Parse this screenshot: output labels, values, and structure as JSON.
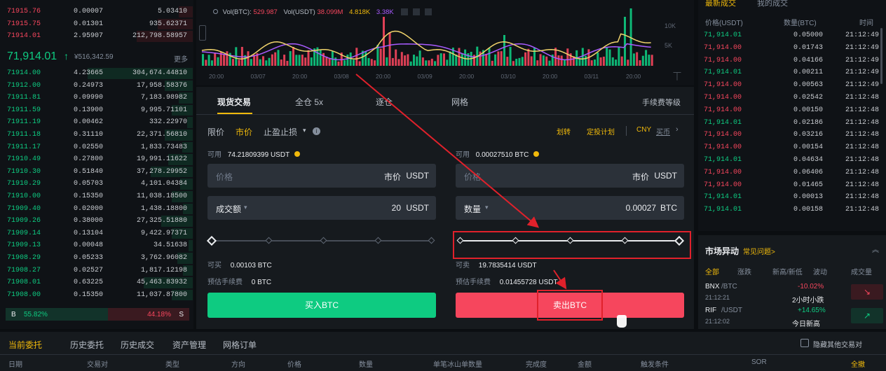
{
  "orderbook": {
    "asks": [
      {
        "price": "71915.76",
        "amount": "0.00007",
        "total": "5.03410"
      },
      {
        "price": "71915.75",
        "amount": "0.01301",
        "total": "935.62371"
      },
      {
        "price": "71914.01",
        "amount": "2.95907",
        "total": "212,798.58957"
      }
    ],
    "last_price": "71,914.01",
    "last_price_arrow": "↑",
    "last_price_fiat": "¥516,342.59",
    "more_label": "更多",
    "bids": [
      {
        "price": "71914.00",
        "amount": "4.23665",
        "total": "304,674.44810"
      },
      {
        "price": "71912.00",
        "amount": "0.24973",
        "total": "17,958.58376"
      },
      {
        "price": "71911.81",
        "amount": "0.09990",
        "total": "7,183.98982"
      },
      {
        "price": "71911.59",
        "amount": "0.13900",
        "total": "9,995.71101"
      },
      {
        "price": "71911.19",
        "amount": "0.00462",
        "total": "332.22970"
      },
      {
        "price": "71911.18",
        "amount": "0.31110",
        "total": "22,371.56810"
      },
      {
        "price": "71911.17",
        "amount": "0.02550",
        "total": "1,833.73483"
      },
      {
        "price": "71910.49",
        "amount": "0.27800",
        "total": "19,991.11622"
      },
      {
        "price": "71910.30",
        "amount": "0.51840",
        "total": "37,278.29952"
      },
      {
        "price": "71910.29",
        "amount": "0.05703",
        "total": "4,101.04384"
      },
      {
        "price": "71910.00",
        "amount": "0.15350",
        "total": "11,038.18500"
      },
      {
        "price": "71909.40",
        "amount": "0.02000",
        "total": "1,438.18800"
      },
      {
        "price": "71909.26",
        "amount": "0.38000",
        "total": "27,325.51880"
      },
      {
        "price": "71909.14",
        "amount": "0.13104",
        "total": "9,422.97371"
      },
      {
        "price": "71909.13",
        "amount": "0.00048",
        "total": "34.51638"
      },
      {
        "price": "71908.29",
        "amount": "0.05233",
        "total": "3,762.96082"
      },
      {
        "price": "71908.27",
        "amount": "0.02527",
        "total": "1,817.12198"
      },
      {
        "price": "71908.01",
        "amount": "0.63225",
        "total": "45,463.83932"
      },
      {
        "price": "71908.00",
        "amount": "0.15350",
        "total": "11,037.87800"
      }
    ],
    "ratio": {
      "b_label": "B",
      "b_pct": "55.82%",
      "s_pct": "44.18%",
      "s_label": "S",
      "b_fraction": 0.5582
    }
  },
  "chart": {
    "vol_btc_label": "Vol(BTC):",
    "vol_btc": "529.987",
    "vol_usdt_label": "Vol(USDT)",
    "vol_usdt": "38.099M",
    "v1": "4.818K",
    "v2": "3.38K",
    "y_ticks": [
      "10K",
      "5K"
    ],
    "x_ticks": [
      "20:00",
      "03/07",
      "20:00",
      "03/08",
      "20:00",
      "03/09",
      "20:00",
      "03/10",
      "20:00",
      "03/11",
      "20:00"
    ]
  },
  "trade_tabs": {
    "spot": "现货交易",
    "cross": "全仓 5x",
    "isolated": "逐仓",
    "grid": "网格",
    "fee": "手续费等级"
  },
  "order_types": {
    "limit": "限价",
    "market": "市价",
    "stop": "止盈止损",
    "transfer": "划转",
    "plan": "定投计划",
    "cny": "CNY",
    "buy_link": "买币"
  },
  "buy": {
    "avail_label": "可用",
    "avail": "74.21809399 USDT",
    "price_ph": "价格",
    "price_mode": "市价",
    "price_unit": "USDT",
    "amt_label": "成交额",
    "amt_value": "20",
    "amt_unit": "USDT",
    "can_label": "可买",
    "can_value": "0.00103 BTC",
    "fee_label": "预估手续费",
    "fee_value": "0 BTC",
    "button": "买入BTC"
  },
  "sell": {
    "avail_label": "可用",
    "avail": "0.00027510 BTC",
    "price_ph": "价格",
    "price_mode": "市价",
    "price_unit": "USDT",
    "amt_label": "数量",
    "amt_value": "0.00027",
    "amt_unit": "BTC",
    "can_label": "可卖",
    "can_value": "19.7835414 USDT",
    "fee_label": "预估手续费",
    "fee_value": "0.01455728 USDT",
    "button": "卖出BTC"
  },
  "trades": {
    "tab_latest": "最新成交",
    "tab_mine": "我的成交",
    "headers": [
      "价格(USDT)",
      "数量(BTC)",
      "时间"
    ],
    "rows": [
      {
        "price": "71,914.01",
        "amount": "0.05000",
        "time": "21:12:49",
        "side": "buy"
      },
      {
        "price": "71,914.00",
        "amount": "0.01743",
        "time": "21:12:49",
        "side": "sell"
      },
      {
        "price": "71,914.00",
        "amount": "0.04166",
        "time": "21:12:49",
        "side": "sell"
      },
      {
        "price": "71,914.01",
        "amount": "0.00211",
        "time": "21:12:49",
        "side": "buy"
      },
      {
        "price": "71,914.00",
        "amount": "0.00563",
        "time": "21:12:49",
        "side": "sell"
      },
      {
        "price": "71,914.00",
        "amount": "0.02542",
        "time": "21:12:48",
        "side": "sell"
      },
      {
        "price": "71,914.00",
        "amount": "0.00150",
        "time": "21:12:48",
        "side": "sell"
      },
      {
        "price": "71,914.01",
        "amount": "0.02186",
        "time": "21:12:48",
        "side": "buy"
      },
      {
        "price": "71,914.00",
        "amount": "0.03216",
        "time": "21:12:48",
        "side": "sell"
      },
      {
        "price": "71,914.00",
        "amount": "0.00154",
        "time": "21:12:48",
        "side": "sell"
      },
      {
        "price": "71,914.01",
        "amount": "0.04634",
        "time": "21:12:48",
        "side": "buy"
      },
      {
        "price": "71,914.00",
        "amount": "0.06406",
        "time": "21:12:48",
        "side": "sell"
      },
      {
        "price": "71,914.00",
        "amount": "0.01465",
        "time": "21:12:48",
        "side": "sell"
      },
      {
        "price": "71,914.01",
        "amount": "0.00013",
        "time": "21:12:48",
        "side": "buy"
      },
      {
        "price": "71,914.01",
        "amount": "0.00158",
        "time": "21:12:48",
        "side": "buy"
      }
    ]
  },
  "market": {
    "title": "市场异动",
    "faq": "常见问题>",
    "tabs": [
      "全部",
      "涨跌",
      "新高/新低",
      "波动",
      "成交量"
    ],
    "items": [
      {
        "pair": "BNX",
        "quote": "/BTC",
        "time": "21:12:21",
        "change": "-10.02%",
        "desc": "2小时小跌",
        "dir": "down"
      },
      {
        "pair": "RIF",
        "quote": "/USDT",
        "time": "21:12:02",
        "change": "+14.65%",
        "desc": "今日新高",
        "dir": "up"
      }
    ]
  },
  "bottom": {
    "tabs": [
      "当前委托",
      "历史委托",
      "历史成交",
      "资产管理",
      "网格订单"
    ],
    "hide_others": "隐藏其他交易对",
    "columns": [
      "日期",
      "交易对",
      "类型",
      "方向",
      "价格",
      "数量",
      "单笔冰山单数量",
      "完成度",
      "金额",
      "触发条件",
      "SOR",
      "全撤"
    ]
  },
  "colors": {
    "red": "#f6465d",
    "green": "#0ecb81",
    "yellow": "#f0b90b",
    "panel": "#161a1e"
  }
}
